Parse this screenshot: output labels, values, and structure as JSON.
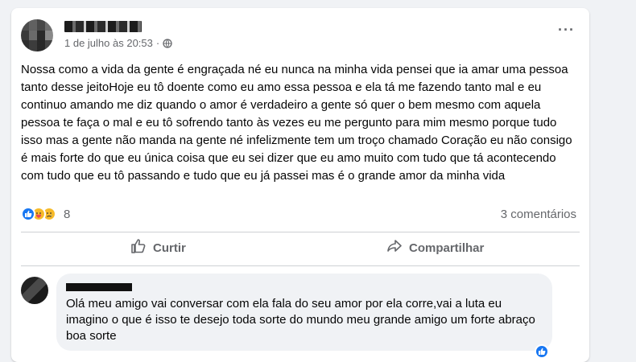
{
  "post": {
    "date": "1 de julho às 20:53",
    "separator": "·",
    "text": "Nossa como a vida da gente é engraçada né eu nunca na minha vida pensei que ia amar uma pessoa tanto desse jeitoHoje eu tô doente como eu amo essa pessoa e ela tá me fazendo tanto mal e eu continuo amando me diz quando o amor é verdadeiro a gente só quer o bem mesmo com aquela pessoa te faça o mal e eu tô sofrendo tanto às vezes eu me pergunto para mim mesmo porque tudo isso mas a gente não manda na gente né infelizmente tem um troço chamado Coração eu não consigo é mais forte do que eu única coisa que eu sei dizer que eu amo muito com tudo que tá acontecendo com tudo que eu tô passando e tudo que eu já passei mas é o grande amor da minha vida",
    "reaction_count": "8",
    "comments_label": "3 comentários"
  },
  "actions": {
    "like_label": "Curtir",
    "share_label": "Compartilhar"
  },
  "comment": {
    "text": "Olá meu amigo vai conversar com ela fala do seu amor por ela corre,vai a luta eu imagino o que é isso te desejo toda sorte do mundo meu grande amigo um forte abraço boa sorte"
  },
  "icons": {
    "more": "more-options-icon",
    "privacy": "globe-icon",
    "like": "thumbs-up-icon",
    "share": "share-arrow-icon"
  },
  "colors": {
    "accent": "#1877f2",
    "muted": "#65676b",
    "background": "#f0f2f5"
  }
}
